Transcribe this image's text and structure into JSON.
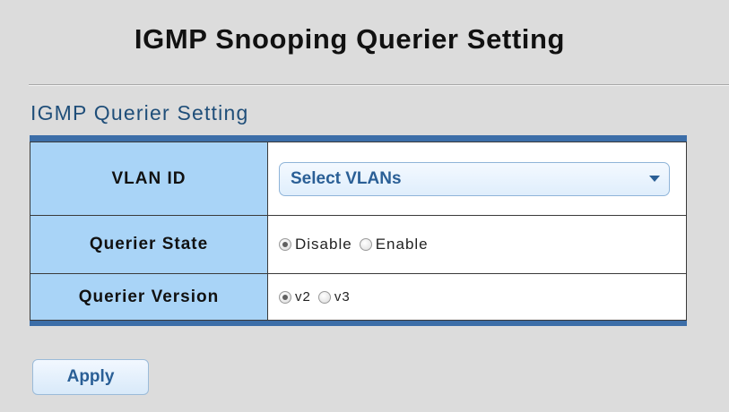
{
  "header": {
    "title": "IGMP Snooping Querier Setting"
  },
  "section": {
    "title": "IGMP Querier Setting"
  },
  "form": {
    "vlan_id": {
      "label": "VLAN ID",
      "select_value": "Select VLANs"
    },
    "querier_state": {
      "label": "Querier State",
      "options": [
        {
          "label": "Disable",
          "selected": true
        },
        {
          "label": "Enable",
          "selected": false
        }
      ]
    },
    "querier_version": {
      "label": "Querier Version",
      "options": [
        {
          "label": "v2",
          "selected": true
        },
        {
          "label": "v3",
          "selected": false
        }
      ]
    }
  },
  "actions": {
    "apply_label": "Apply"
  },
  "colors": {
    "accent": "#3c6ea8",
    "label_bg": "#a9d4f7",
    "section_title": "#1f4e79",
    "page_bg": "#dcdcdc"
  }
}
